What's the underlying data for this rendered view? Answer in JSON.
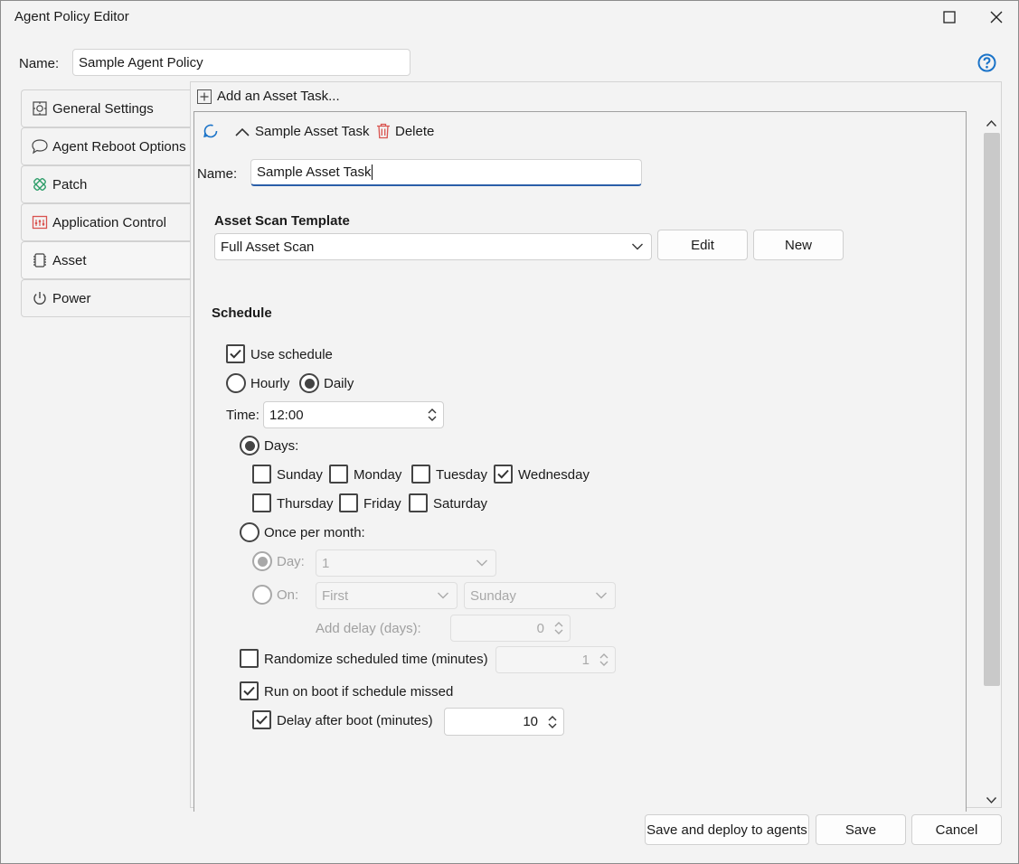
{
  "window": {
    "title": "Agent Policy Editor"
  },
  "policy": {
    "name_label": "Name:",
    "name_value": "Sample Agent Policy"
  },
  "sidebar": {
    "items": [
      {
        "label": "General Settings",
        "icon": "gear-icon"
      },
      {
        "label": "Agent Reboot Options",
        "icon": "speech-bubble-icon"
      },
      {
        "label": "Patch",
        "icon": "patch-icon"
      },
      {
        "label": "Application Control",
        "icon": "app-control-icon"
      },
      {
        "label": "Asset",
        "icon": "chip-icon"
      },
      {
        "label": "Power",
        "icon": "power-icon"
      }
    ],
    "active": "Asset"
  },
  "task_panel": {
    "add_task_label": "Add an Asset Task...",
    "task_title": "Sample Asset Task",
    "delete_label": "Delete",
    "name_label": "Name:",
    "name_value": "Sample Asset Task",
    "template_heading": "Asset Scan Template",
    "template_selected": "Full Asset Scan",
    "edit_label": "Edit",
    "new_label": "New"
  },
  "schedule": {
    "heading": "Schedule",
    "use_schedule_label": "Use schedule",
    "use_schedule_checked": true,
    "hourly_label": "Hourly",
    "daily_label": "Daily",
    "frequency": "Daily",
    "time_label": "Time:",
    "time_value": "12:00",
    "days_label": "Days:",
    "days_mode": "Days",
    "days": [
      {
        "label": "Sunday",
        "checked": false
      },
      {
        "label": "Monday",
        "checked": false
      },
      {
        "label": "Tuesday",
        "checked": false
      },
      {
        "label": "Wednesday",
        "checked": true
      },
      {
        "label": "Thursday",
        "checked": false
      },
      {
        "label": "Friday",
        "checked": false
      },
      {
        "label": "Saturday",
        "checked": false
      }
    ],
    "once_per_month_label": "Once per month:",
    "month_day_label": "Day:",
    "month_day_value": "1",
    "month_on_label": "On:",
    "month_on_week": "First",
    "month_on_weekday": "Sunday",
    "add_delay_label": "Add delay (days):",
    "add_delay_value": "0",
    "randomize_label": "Randomize scheduled time (minutes)",
    "randomize_checked": false,
    "randomize_value": "1",
    "run_on_boot_label": "Run on boot if schedule missed",
    "run_on_boot_checked": true,
    "delay_after_boot_label": "Delay after boot (minutes)",
    "delay_after_boot_checked": true,
    "delay_after_boot_value": "10"
  },
  "footer": {
    "save_deploy_label": "Save and deploy to agents",
    "save_label": "Save",
    "cancel_label": "Cancel"
  },
  "colors": {
    "accent": "#2a5ea8",
    "help": "#1a73c8",
    "delete_icon": "#d9534f",
    "patch_icon": "#2e9e6a",
    "app_control_icon": "#d9534f"
  }
}
